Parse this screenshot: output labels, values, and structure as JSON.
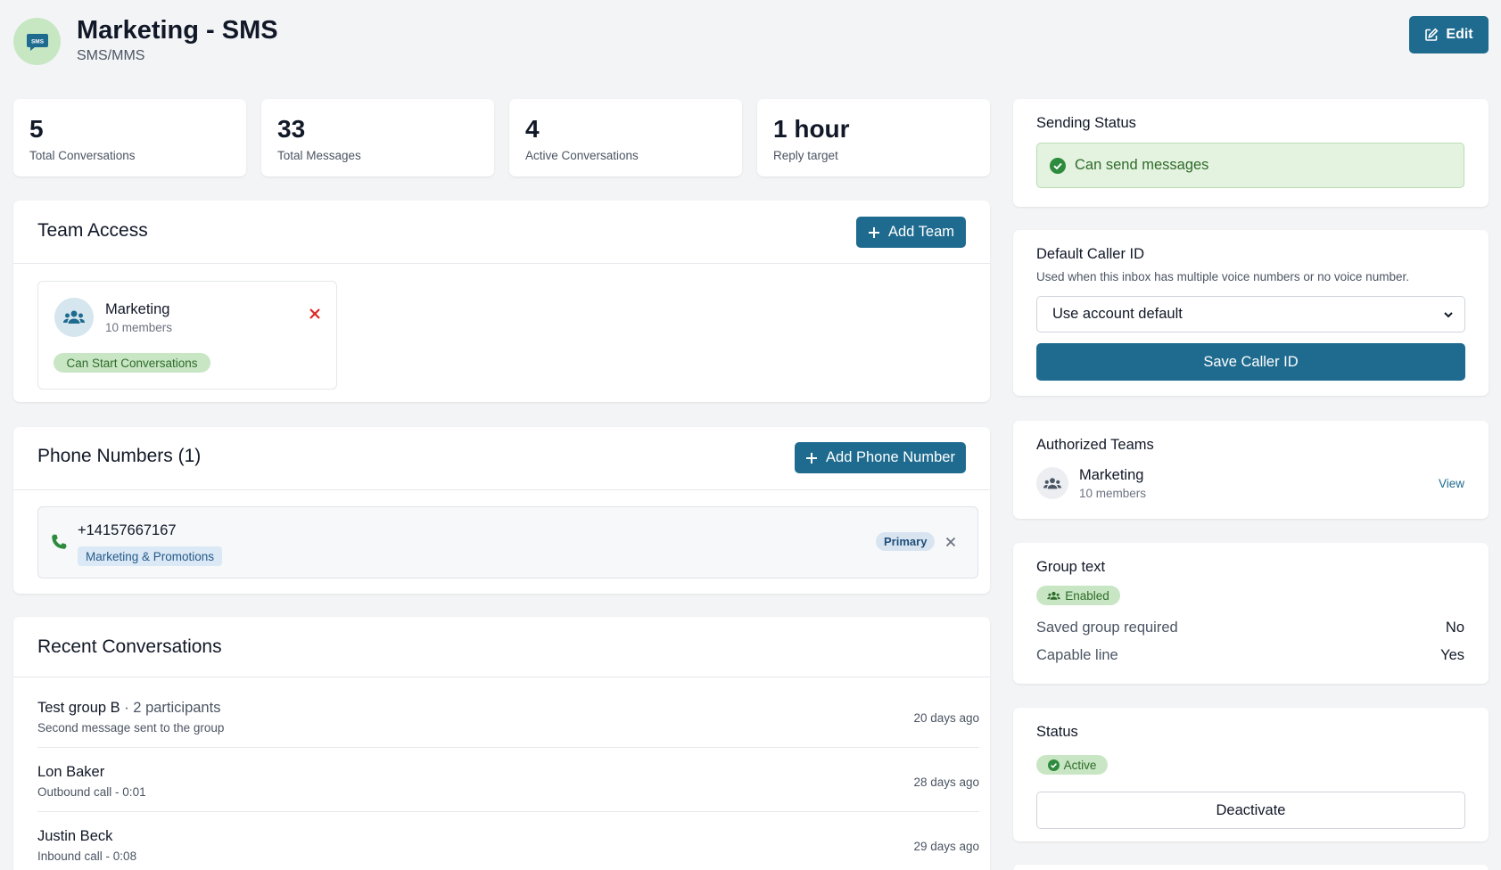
{
  "header": {
    "icon_text": "SMS",
    "title": "Marketing - SMS",
    "subtitle": "SMS/MMS",
    "edit_label": "Edit"
  },
  "stats": [
    {
      "value": "5",
      "label": "Total Conversations"
    },
    {
      "value": "33",
      "label": "Total Messages"
    },
    {
      "value": "4",
      "label": "Active Conversations"
    },
    {
      "value": "1 hour",
      "label": "Reply target"
    }
  ],
  "team_access": {
    "title": "Team Access",
    "add_label": "Add Team",
    "team": {
      "name": "Marketing",
      "members": "10 members",
      "permission": "Can Start Conversations"
    }
  },
  "phone_numbers": {
    "title": "Phone Numbers (1)",
    "add_label": "Add Phone Number",
    "number": "+14157667167",
    "tag": "Marketing & Promotions",
    "primary": "Primary"
  },
  "recent_conversations": {
    "title": "Recent Conversations",
    "items": [
      {
        "name": "Test group B",
        "participants": " · 2 participants",
        "sub": "Second message sent to the group",
        "time": "20 days ago"
      },
      {
        "name": "Lon Baker",
        "participants": "",
        "sub": "Outbound call - 0:01",
        "time": "28 days ago"
      },
      {
        "name": "Justin Beck",
        "participants": "",
        "sub": "Inbound call - 0:08",
        "time": "29 days ago"
      }
    ]
  },
  "sending_status": {
    "title": "Sending Status",
    "status": "Can send messages"
  },
  "caller_id": {
    "title": "Default Caller ID",
    "description": "Used when this inbox has multiple voice numbers or no voice number.",
    "selected": "Use account default",
    "save_label": "Save Caller ID"
  },
  "authorized_teams": {
    "title": "Authorized Teams",
    "team": "Marketing",
    "members": "10 members",
    "view_label": "View"
  },
  "group_text": {
    "title": "Group text",
    "badge": "Enabled",
    "rows": [
      {
        "key": "Saved group required",
        "value": "No"
      },
      {
        "key": "Capable line",
        "value": "Yes"
      }
    ]
  },
  "status": {
    "title": "Status",
    "badge": "Active",
    "deactivate_label": "Deactivate"
  },
  "colors": {
    "primary": "#1f6b8f",
    "success_bg": "#c8e6c4",
    "success_text": "#2f6b2a",
    "danger": "#dc2626"
  }
}
